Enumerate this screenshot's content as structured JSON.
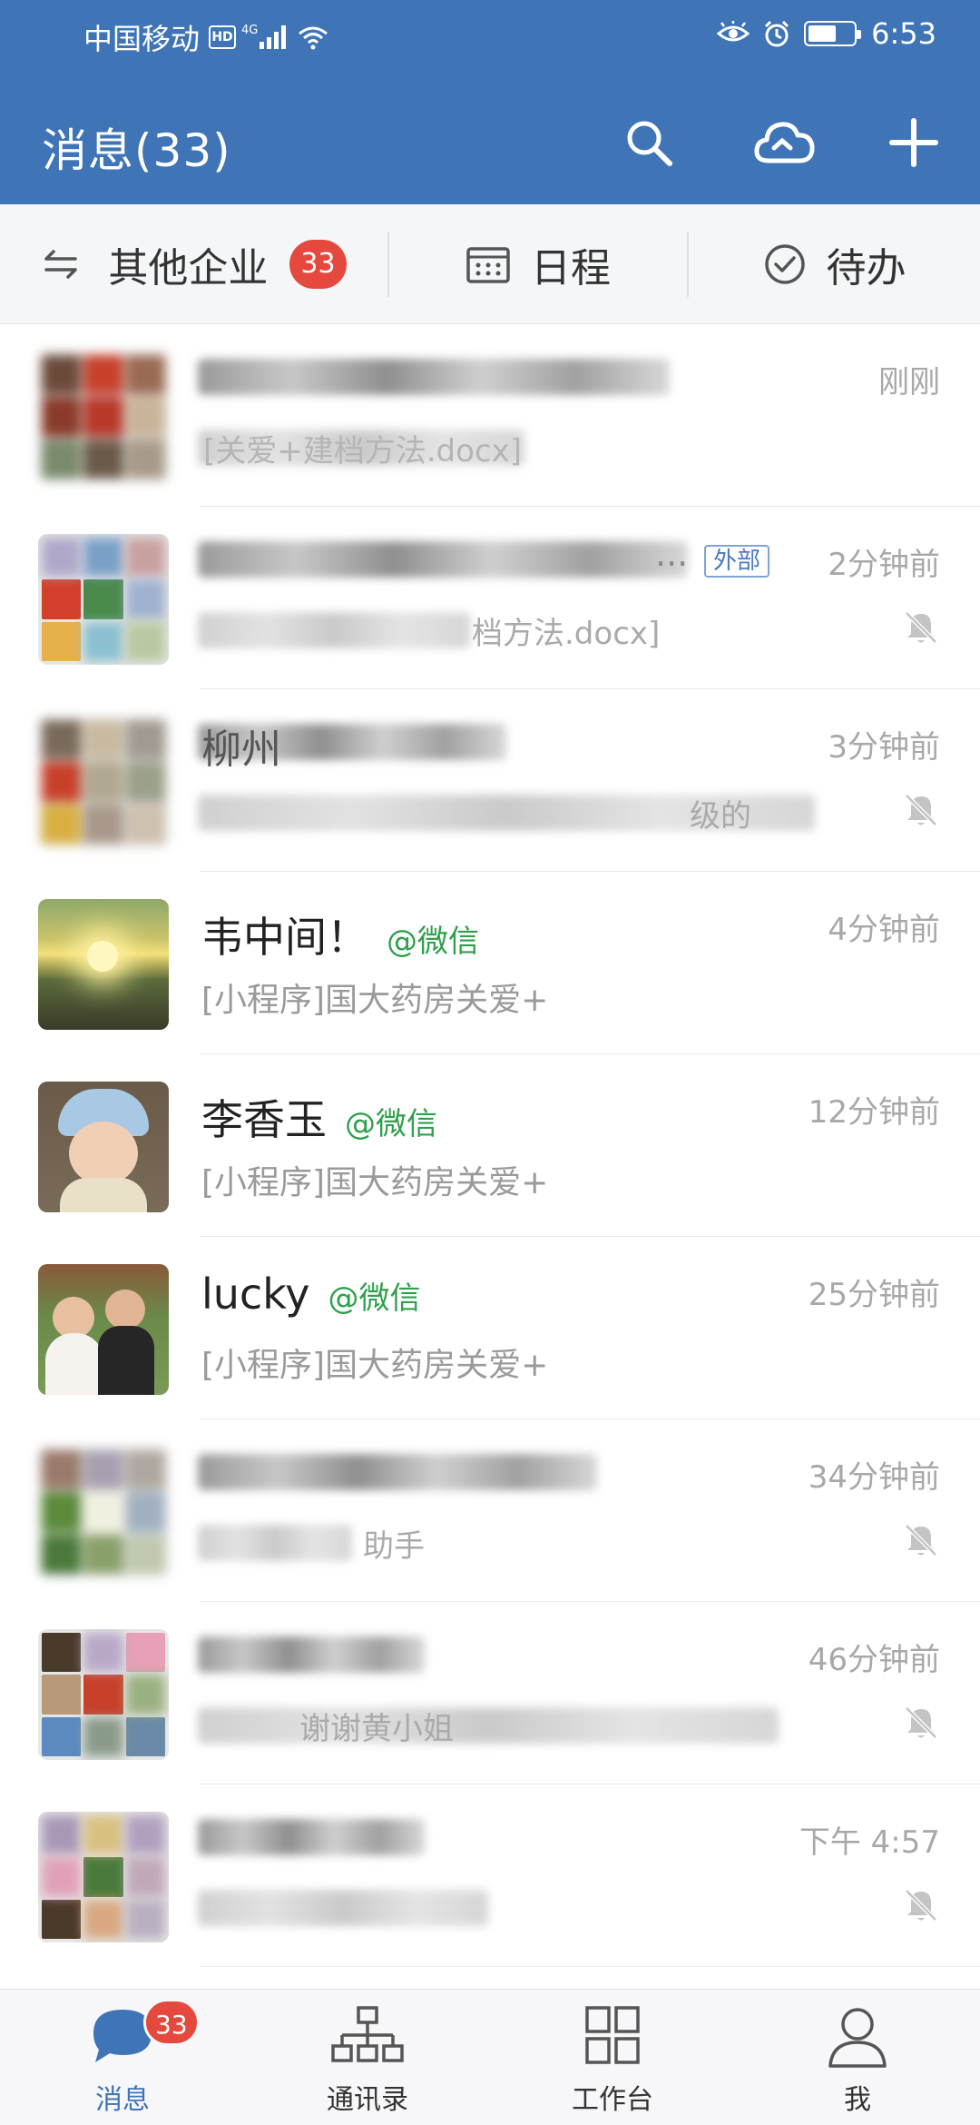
{
  "status_bar": {
    "carrier": "中国移动",
    "hd_label": "HD",
    "network_type": "4G",
    "time": "6:53"
  },
  "header": {
    "title": "消息(33)"
  },
  "sub_tabs": {
    "other_companies": {
      "label": "其他企业",
      "badge": "33"
    },
    "schedule": {
      "label": "日程"
    },
    "todo": {
      "label": "待办"
    }
  },
  "conversations": [
    {
      "name_obscured": true,
      "preview_visible_fragment": "[关爱+建档方法.docx]",
      "time": "刚刚",
      "muted": false
    },
    {
      "name_obscured": true,
      "name_visible_fragment": "...",
      "tag": "外部",
      "preview_visible_fragment": "档方法.docx]",
      "time": "2分钟前",
      "muted": true
    },
    {
      "name_obscured": true,
      "name_visible_fragment": "柳州",
      "preview_visible_fragment": "级的",
      "time": "3分钟前",
      "muted": true
    },
    {
      "name": "韦中间！",
      "source_tag": "@微信",
      "preview": "[小程序]国大药房关爱+",
      "time": "4分钟前",
      "muted": false
    },
    {
      "name": "李香玉",
      "source_tag": "@微信",
      "preview": "[小程序]国大药房关爱+",
      "time": "12分钟前",
      "muted": false
    },
    {
      "name": "lucky",
      "source_tag": "@微信",
      "preview": "[小程序]国大药房关爱+",
      "time": "25分钟前",
      "muted": false
    },
    {
      "name_obscured": true,
      "preview_visible_fragment": "助手",
      "time": "34分钟前",
      "muted": true
    },
    {
      "name_obscured": true,
      "preview_visible_fragment": "谢谢黄小姐",
      "time": "46分钟前",
      "muted": true
    },
    {
      "name_obscured": true,
      "time": "下午 4:57",
      "muted": true
    }
  ],
  "bottom_nav": [
    {
      "label": "消息",
      "icon": "chat-bubble-icon",
      "active": true,
      "badge": "33"
    },
    {
      "label": "通讯录",
      "icon": "org-chart-icon",
      "active": false
    },
    {
      "label": "工作台",
      "icon": "grid-apps-icon",
      "active": false
    },
    {
      "label": "我",
      "icon": "person-icon",
      "active": false
    }
  ],
  "colors": {
    "header_bg": "#3f74b6",
    "badge_red": "#e5483d",
    "wechat_green": "#2ea04b",
    "active_blue": "#3f74b6"
  }
}
